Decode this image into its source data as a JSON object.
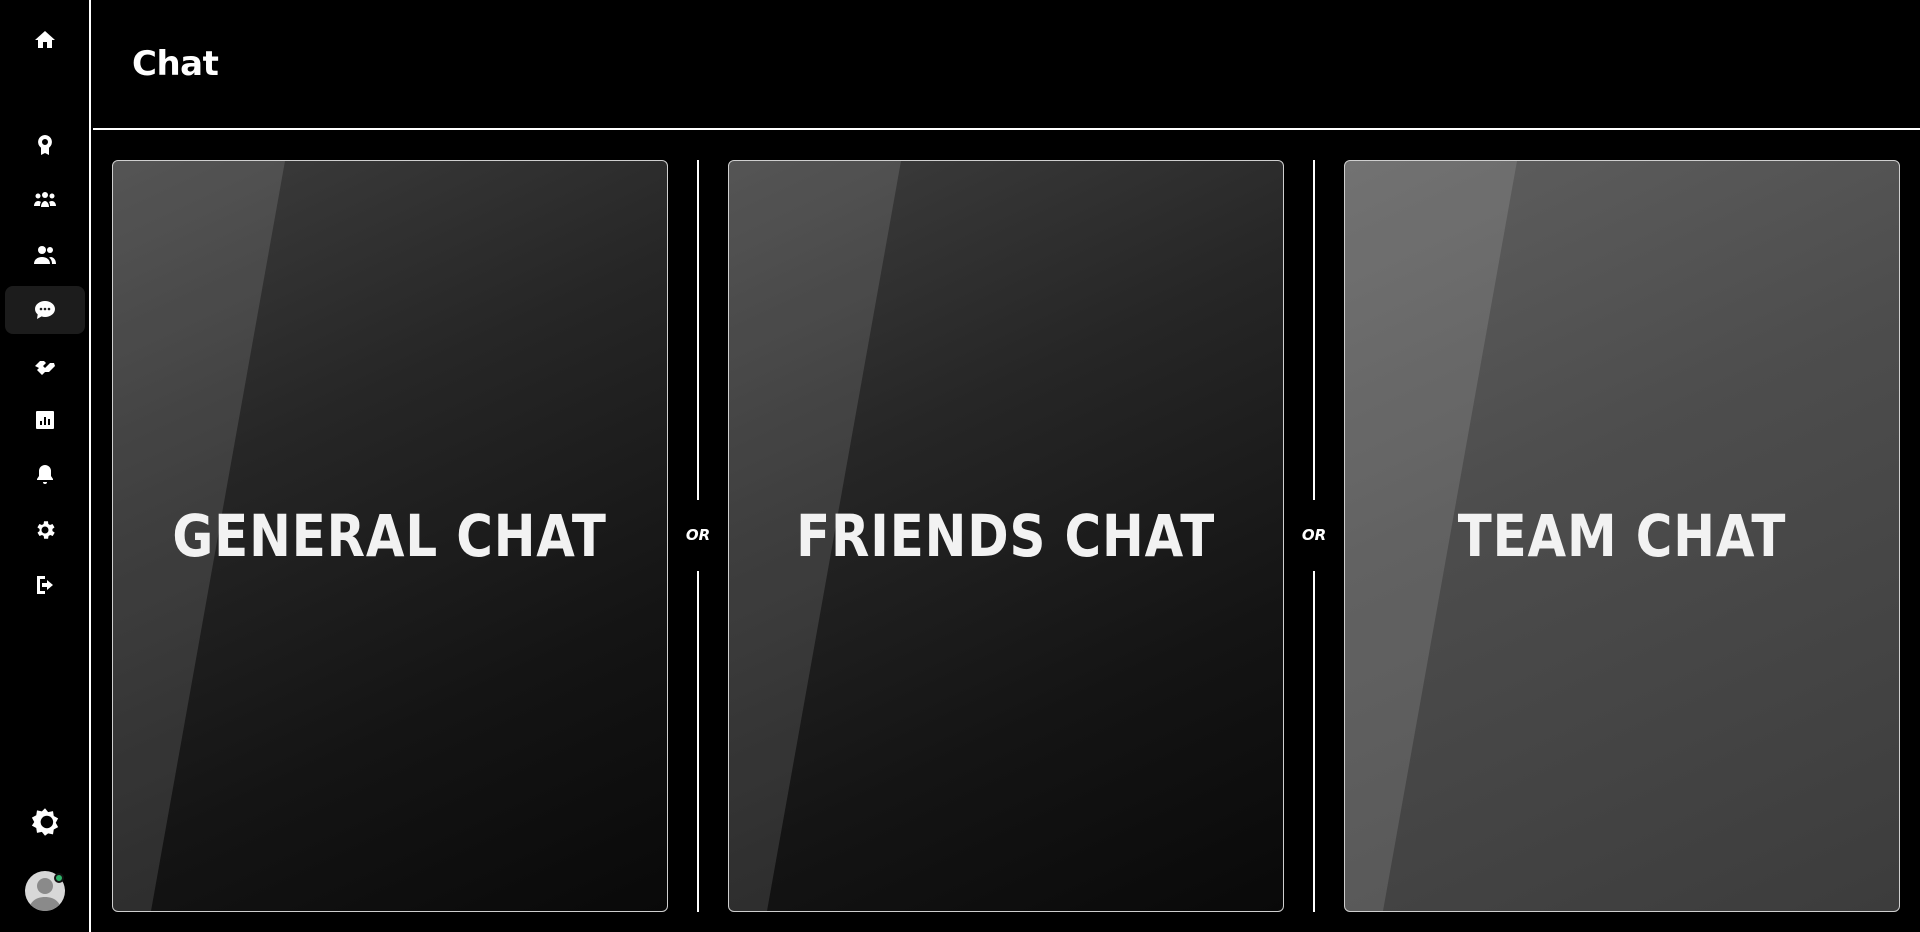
{
  "sidebar": {
    "items": [
      {
        "name": "home-icon",
        "active": false
      },
      {
        "name": "award-icon",
        "active": false
      },
      {
        "name": "teams-icon",
        "active": false
      },
      {
        "name": "friends-icon",
        "active": false
      },
      {
        "name": "chat-icon",
        "active": true
      },
      {
        "name": "handshake-icon",
        "active": false
      },
      {
        "name": "stats-icon",
        "active": false
      },
      {
        "name": "bell-icon",
        "active": false
      },
      {
        "name": "gear-icon",
        "active": false
      },
      {
        "name": "logout-icon",
        "active": false
      }
    ],
    "theme_toggle_icon": "theme-toggle-icon",
    "avatar_status": "online"
  },
  "header": {
    "title": "Chat"
  },
  "main": {
    "cards": [
      {
        "label": "GENERAL CHAT"
      },
      {
        "label": "FRIENDS CHAT"
      },
      {
        "label": "TEAM CHAT"
      }
    ],
    "separators": [
      {
        "label": "OR"
      },
      {
        "label": "OR"
      }
    ]
  },
  "colors": {
    "background": "#000000",
    "active_nav": "#1c1c1c",
    "status_online": "#2fb36a"
  }
}
